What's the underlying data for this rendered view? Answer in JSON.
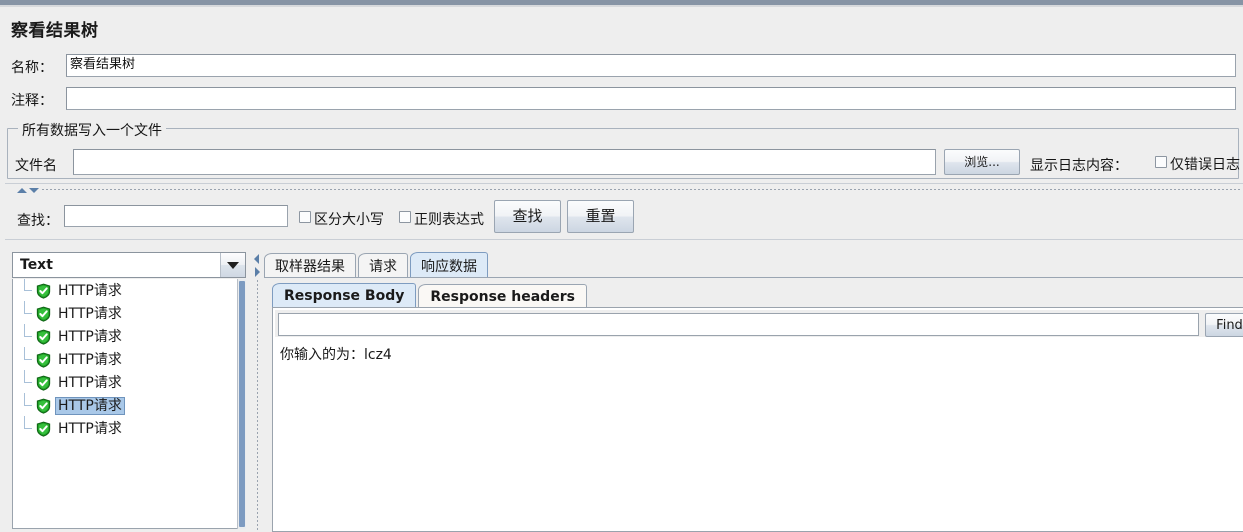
{
  "window": {
    "title": "察看结果树"
  },
  "fields": {
    "name_label": "名称：",
    "name_value": "察看结果树",
    "comment_label": "注释：",
    "comment_value": ""
  },
  "file_group": {
    "legend": "所有数据写入一个文件",
    "filename_label": "文件名",
    "filename_value": "",
    "browse_button": "浏览...",
    "display_log_label": "显示日志内容：",
    "errors_only_label": "仅错误日志"
  },
  "search_bar": {
    "search_label": "查找：",
    "search_value": "",
    "case_sensitive_label": "区分大小写",
    "regex_label": "正则表达式",
    "find_button": "查找",
    "reset_button": "重置"
  },
  "tree_panel": {
    "renderer_selected": "Text",
    "nodes": [
      {
        "label": "HTTP请求",
        "status": "success",
        "selected": false
      },
      {
        "label": "HTTP请求",
        "status": "success",
        "selected": false
      },
      {
        "label": "HTTP请求",
        "status": "success",
        "selected": false
      },
      {
        "label": "HTTP请求",
        "status": "success",
        "selected": false
      },
      {
        "label": "HTTP请求",
        "status": "success",
        "selected": false
      },
      {
        "label": "HTTP请求",
        "status": "success",
        "selected": true
      },
      {
        "label": "HTTP请求",
        "status": "success",
        "selected": false
      }
    ]
  },
  "result_panel": {
    "tabs": [
      {
        "label": "取样器结果",
        "active": false
      },
      {
        "label": "请求",
        "active": false
      },
      {
        "label": "响应数据",
        "active": true
      }
    ],
    "subtabs": [
      {
        "label": "Response Body",
        "active": true
      },
      {
        "label": "Response headers",
        "active": false
      }
    ],
    "find_input_value": "",
    "find_button": "Find",
    "body_text": "你输入的为：lcz4"
  },
  "colors": {
    "window_bg": "#eeeeee",
    "accent_bar": "#8794a5",
    "selection_blue": "#a9c8e8",
    "active_tab_blue": "#ddeaf7",
    "success_green": "#19a319",
    "border_gray": "#9aa3ad"
  }
}
